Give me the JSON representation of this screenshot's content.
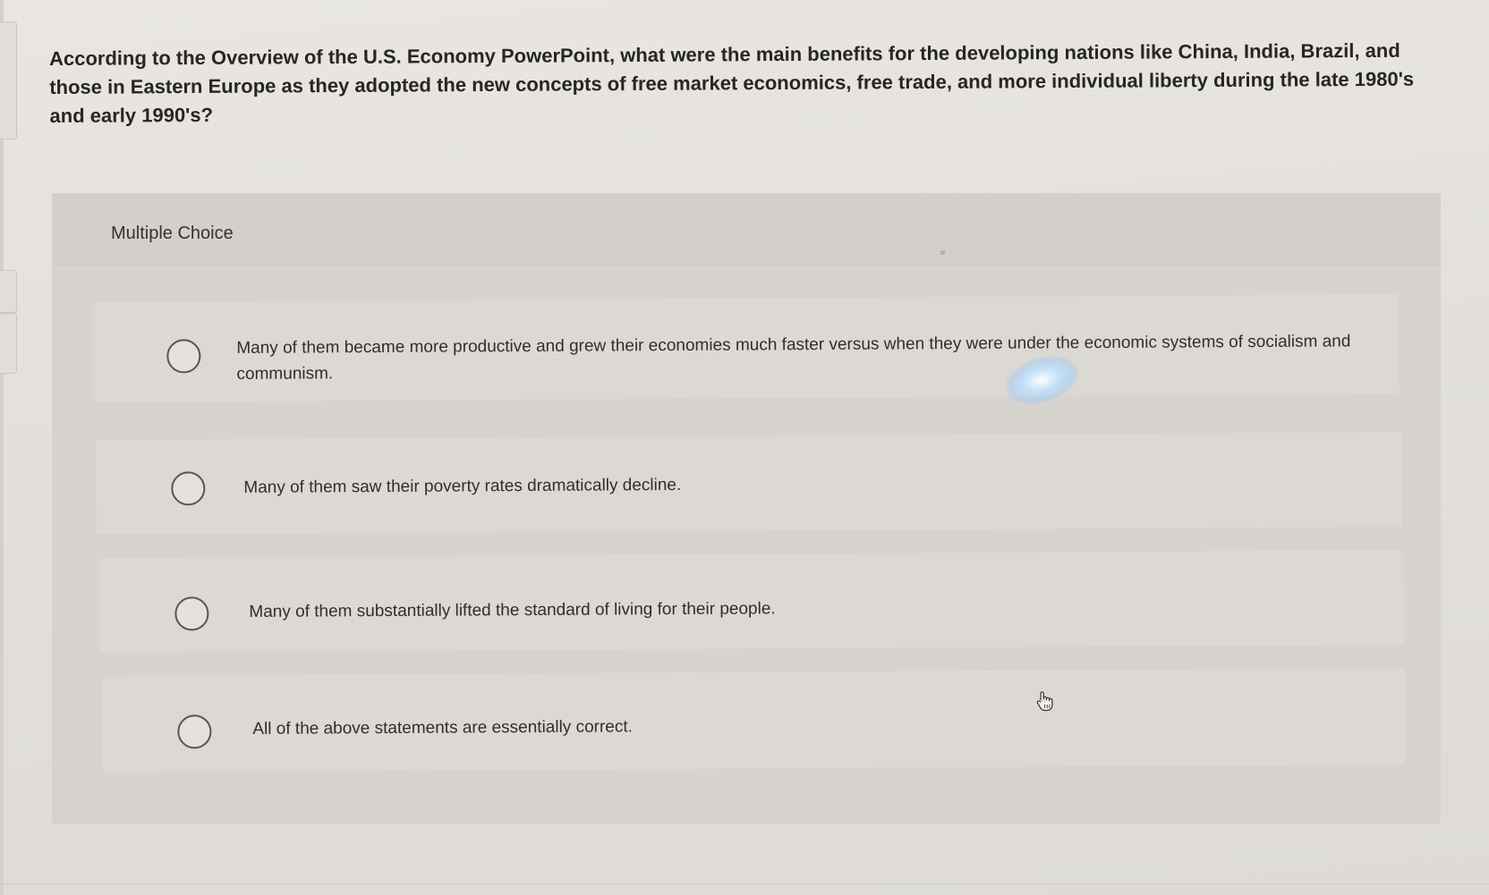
{
  "question": {
    "text": "According to the Overview of the U.S. Economy PowerPoint, what were the main benefits for the developing nations like China, India, Brazil, and those in Eastern Europe as they adopted the new concepts of free market economics, free trade, and more individual liberty during the late 1980's and early 1990's?"
  },
  "multiple_choice": {
    "label": "Multiple Choice",
    "options": [
      {
        "text": "Many of them became more productive and grew their economies much faster versus when they were under the economic systems of socialism and communism.",
        "selected": false
      },
      {
        "text": "Many of them saw their poverty rates dramatically decline.",
        "selected": false
      },
      {
        "text": "Many of them substantially lifted the standard of living for their people.",
        "selected": false
      },
      {
        "text": "All of the above statements are essentially correct.",
        "selected": false
      }
    ]
  },
  "icons": {
    "radio": "radio-button-icon",
    "cursor": "hand-pointer-icon"
  },
  "colors": {
    "background": "#e6e3df",
    "panel": "#d6d3cf",
    "option_background": "#dcd9d5",
    "text": "#262626"
  }
}
